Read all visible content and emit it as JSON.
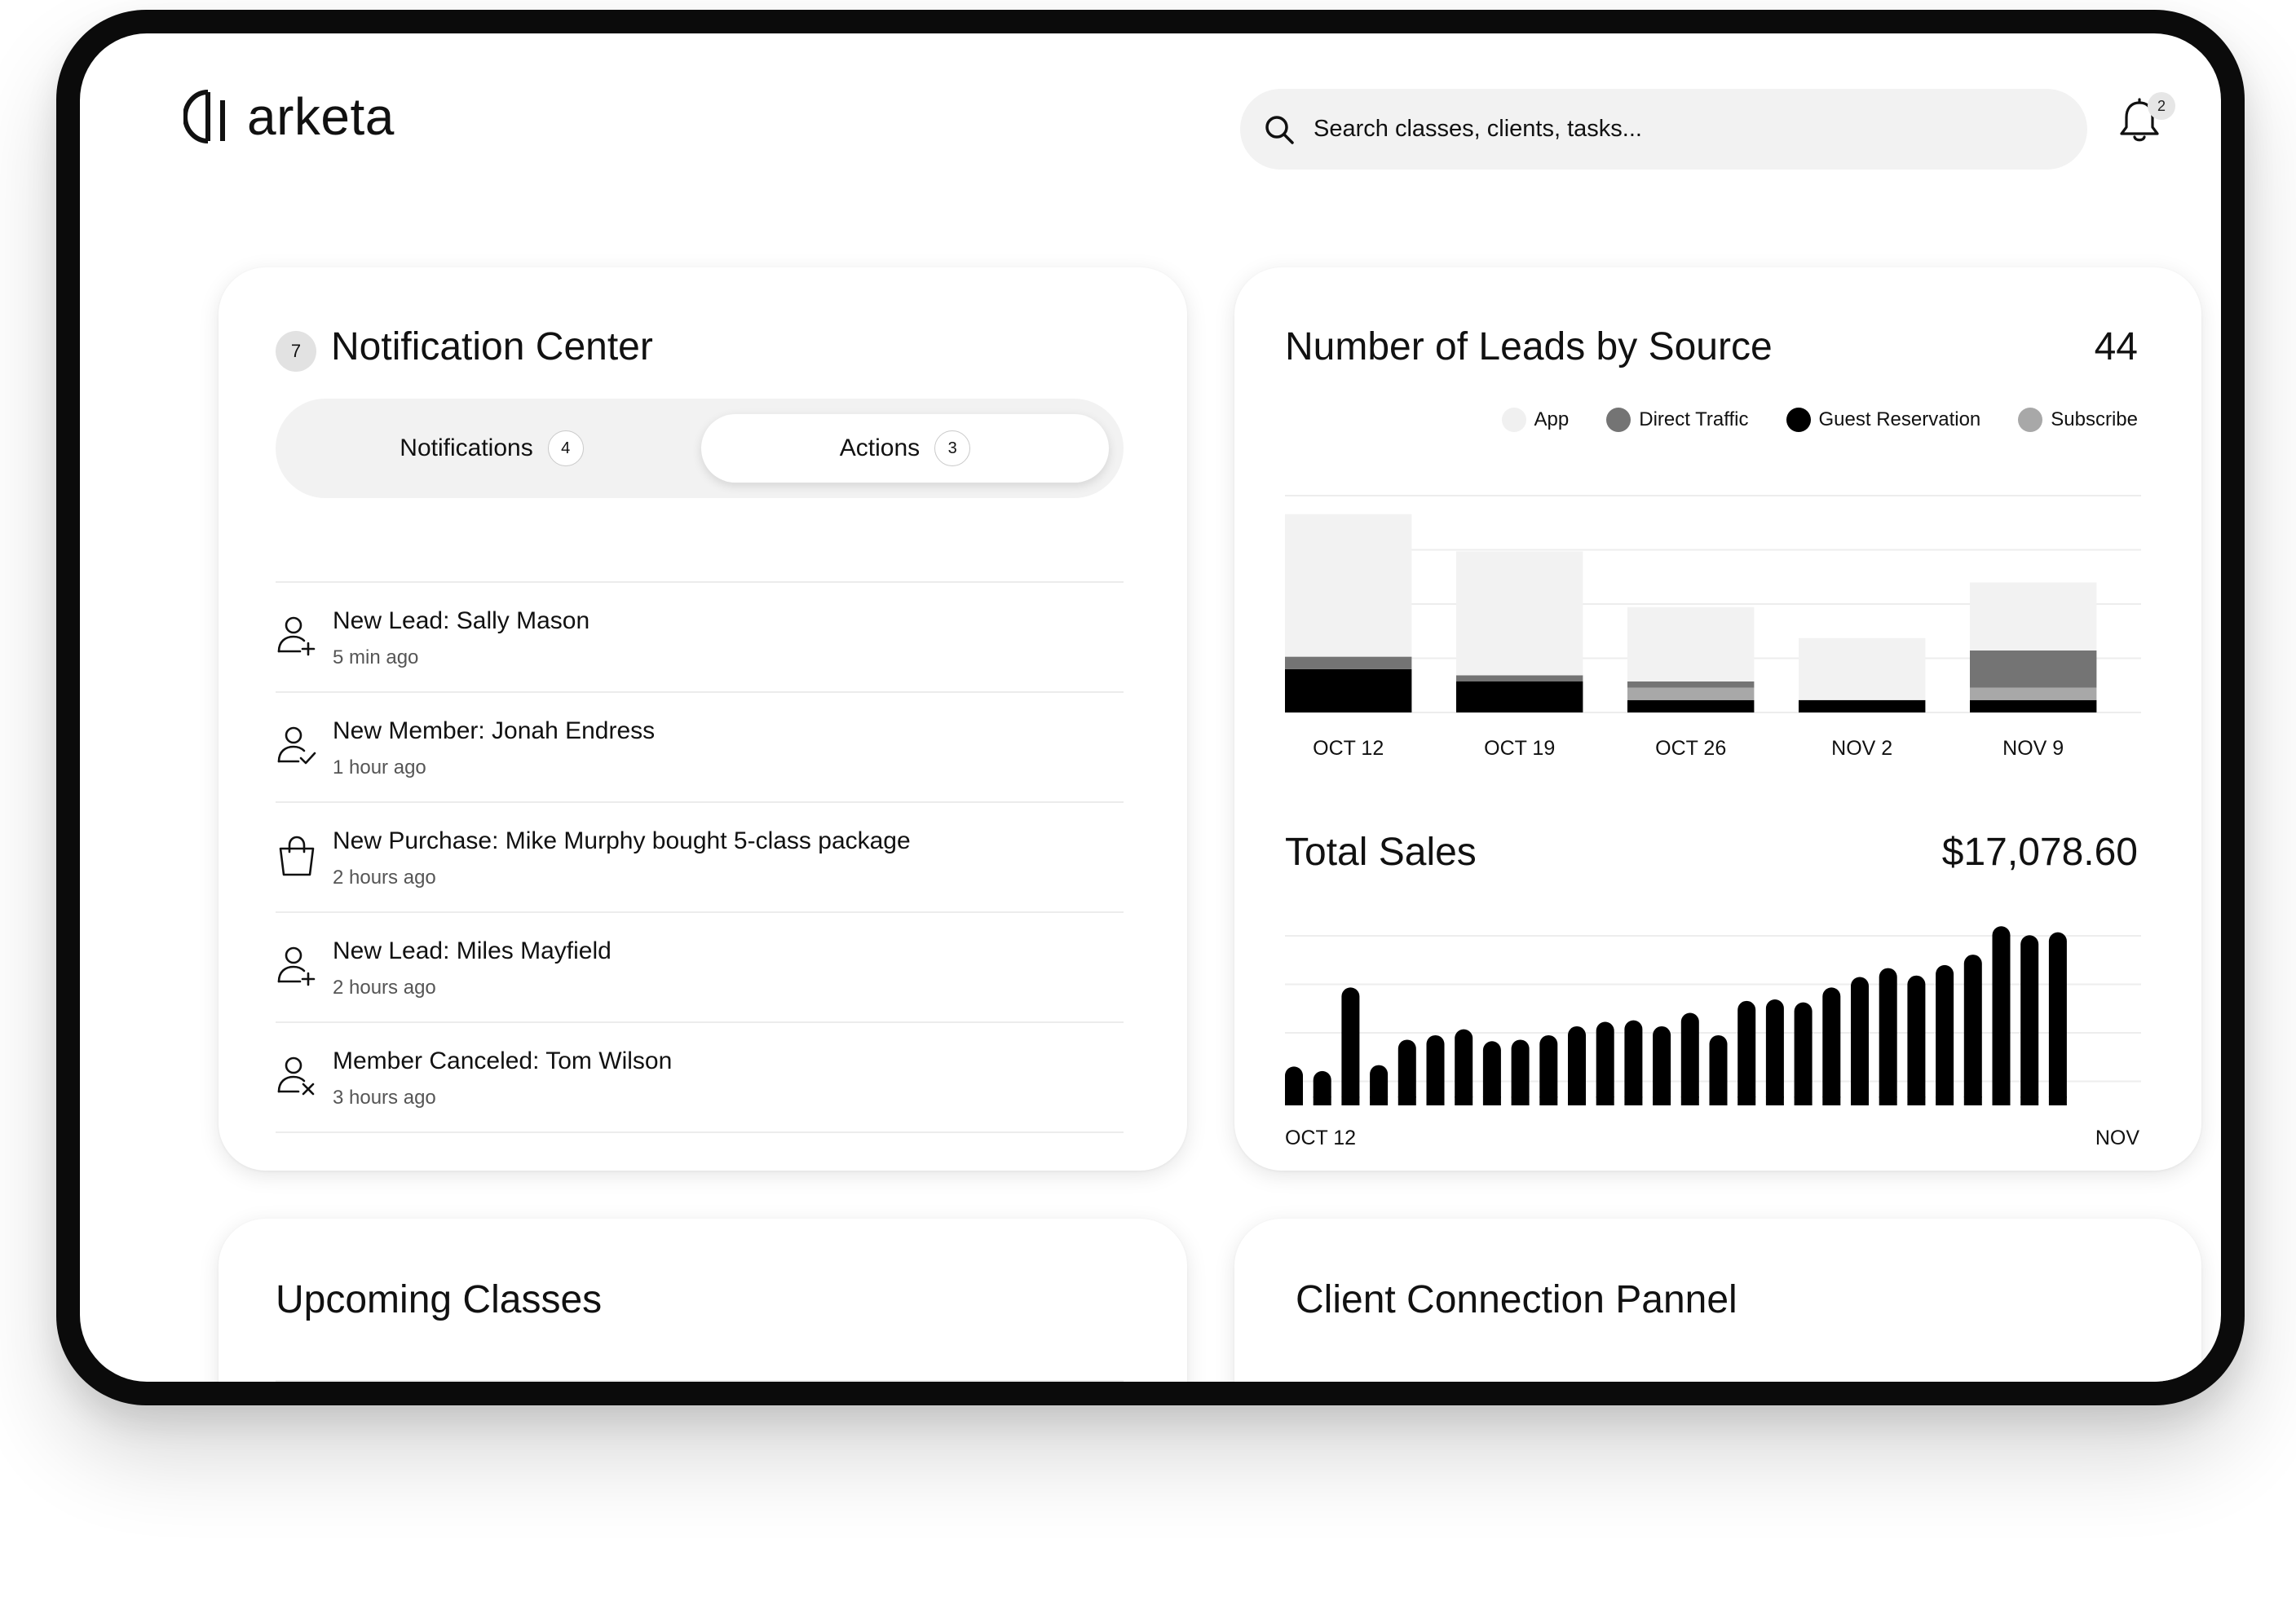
{
  "brand": {
    "name": "arketa"
  },
  "header": {
    "search_placeholder": "Search classes, clients, tasks...",
    "notification_count": "2"
  },
  "notification_center": {
    "count": "7",
    "title": "Notification Center",
    "tabs": [
      {
        "label": "Notifications",
        "count": "4"
      },
      {
        "label": "Actions",
        "count": "3",
        "active": true
      }
    ],
    "items": [
      {
        "icon": "user-plus-icon",
        "title": "New Lead: Sally Mason",
        "time": "5 min ago"
      },
      {
        "icon": "user-check-icon",
        "title": "New Member: Jonah Endress",
        "time": "1 hour ago"
      },
      {
        "icon": "shopping-bag-icon",
        "title": "New Purchase: Mike Murphy bought 5-class package",
        "time": "2 hours ago"
      },
      {
        "icon": "user-plus-icon",
        "title": "New Lead: Miles Mayfield",
        "time": "2 hours ago"
      },
      {
        "icon": "user-x-icon",
        "title": "Member Canceled: Tom Wilson",
        "time": "3 hours ago"
      }
    ]
  },
  "leads_by_source": {
    "title": "Number of Leads by Source",
    "total": "44"
  },
  "total_sales": {
    "title": "Total Sales",
    "total": "$17,078.60"
  },
  "upcoming_classes": {
    "title": "Upcoming Classes"
  },
  "client_connection": {
    "title": "Client Connection Pannel"
  },
  "colors": {
    "app": "#f2f2f2",
    "direct_traffic": "#747474",
    "guest_reservation": "#000000",
    "subscribe": "#a8a8a8",
    "sales_bar": "#000000"
  },
  "chart_data": [
    {
      "type": "bar",
      "stacked": true,
      "title": "Number of Leads by Source",
      "categories": [
        "OCT 12",
        "OCT 19",
        "OCT 26",
        "NOV 2",
        "NOV 9"
      ],
      "series": [
        {
          "name": "Guest Reservation",
          "color": "#000000",
          "values": [
            7,
            5,
            2,
            2,
            2
          ]
        },
        {
          "name": "Subscribe",
          "color": "#a8a8a8",
          "values": [
            0,
            0,
            2,
            0,
            2
          ]
        },
        {
          "name": "Direct Traffic",
          "color": "#747474",
          "values": [
            2,
            1,
            1,
            0,
            6
          ]
        },
        {
          "name": "App",
          "color": "#f2f2f2",
          "values": [
            23,
            20,
            12,
            10,
            11
          ]
        }
      ],
      "ylim": [
        0,
        35
      ],
      "legend": "top-right",
      "grid": true
    },
    {
      "type": "bar",
      "title": "Total Sales",
      "x_tick_labels": [
        "OCT 12",
        "NOV"
      ],
      "values": [
        26,
        23,
        79,
        27,
        44,
        47,
        51,
        43,
        44,
        47,
        53,
        56,
        57,
        53,
        62,
        47,
        70,
        71,
        69,
        79,
        86,
        92,
        87,
        94,
        101,
        120,
        114,
        116
      ],
      "ylim": [
        0,
        130
      ],
      "grid": true
    }
  ]
}
